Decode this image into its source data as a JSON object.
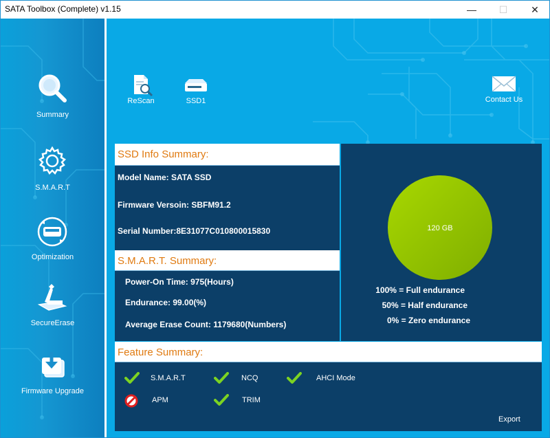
{
  "window": {
    "title": "SATA Toolbox (Complete) v1.15",
    "min_symbol": "—",
    "max_symbol": "☐",
    "close_symbol": "✕"
  },
  "sidebar": {
    "items": [
      {
        "label": "Summary",
        "icon": "magnifier-icon"
      },
      {
        "label": "S.M.A.R.T",
        "icon": "gear-icon"
      },
      {
        "label": "Optimization",
        "icon": "disk-optimize-icon"
      },
      {
        "label": "SecureErase",
        "icon": "eraser-icon"
      },
      {
        "label": "Firmware Upgrade",
        "icon": "download-icon"
      }
    ]
  },
  "toolbar": {
    "rescan_label": "ReScan",
    "ssd_label": "SSD1",
    "contact_label": "Contact Us"
  },
  "ssd_info": {
    "heading": "SSD Info Summary:",
    "model_name": "Model Name: SATA SSD",
    "firmware": "Firmware Versoin: SBFM91.2",
    "serial": "Serial Number:8E31077C010800015830"
  },
  "smart": {
    "heading": "S.M.A.R.T. Summary:",
    "power_on": "Power-On Time: 975(Hours)",
    "endurance": "Endurance: 99.00(%)",
    "erase_count": "Average Erase Count: 1179680(Numbers)"
  },
  "capacity": {
    "label": "120 GB",
    "endurance_percent": 99.0,
    "fill_color": "#9ccd00",
    "legend_full": "100% = Full endurance",
    "legend_half": "50% = Half endurance",
    "legend_zero": "0% = Zero endurance"
  },
  "features": {
    "heading": "Feature Summary:",
    "items": [
      {
        "label": "S.M.A.R.T",
        "status": "supported"
      },
      {
        "label": "NCQ",
        "status": "supported"
      },
      {
        "label": "AHCI Mode",
        "status": "supported"
      },
      {
        "label": "APM",
        "status": "unsupported"
      },
      {
        "label": "TRIM",
        "status": "supported"
      }
    ],
    "export_label": "Export"
  },
  "colors": {
    "accent": "#09a9e6",
    "panel": "#0c3f68",
    "heading": "#e07a10",
    "check": "#7cd322",
    "forbid": "#e02020"
  }
}
